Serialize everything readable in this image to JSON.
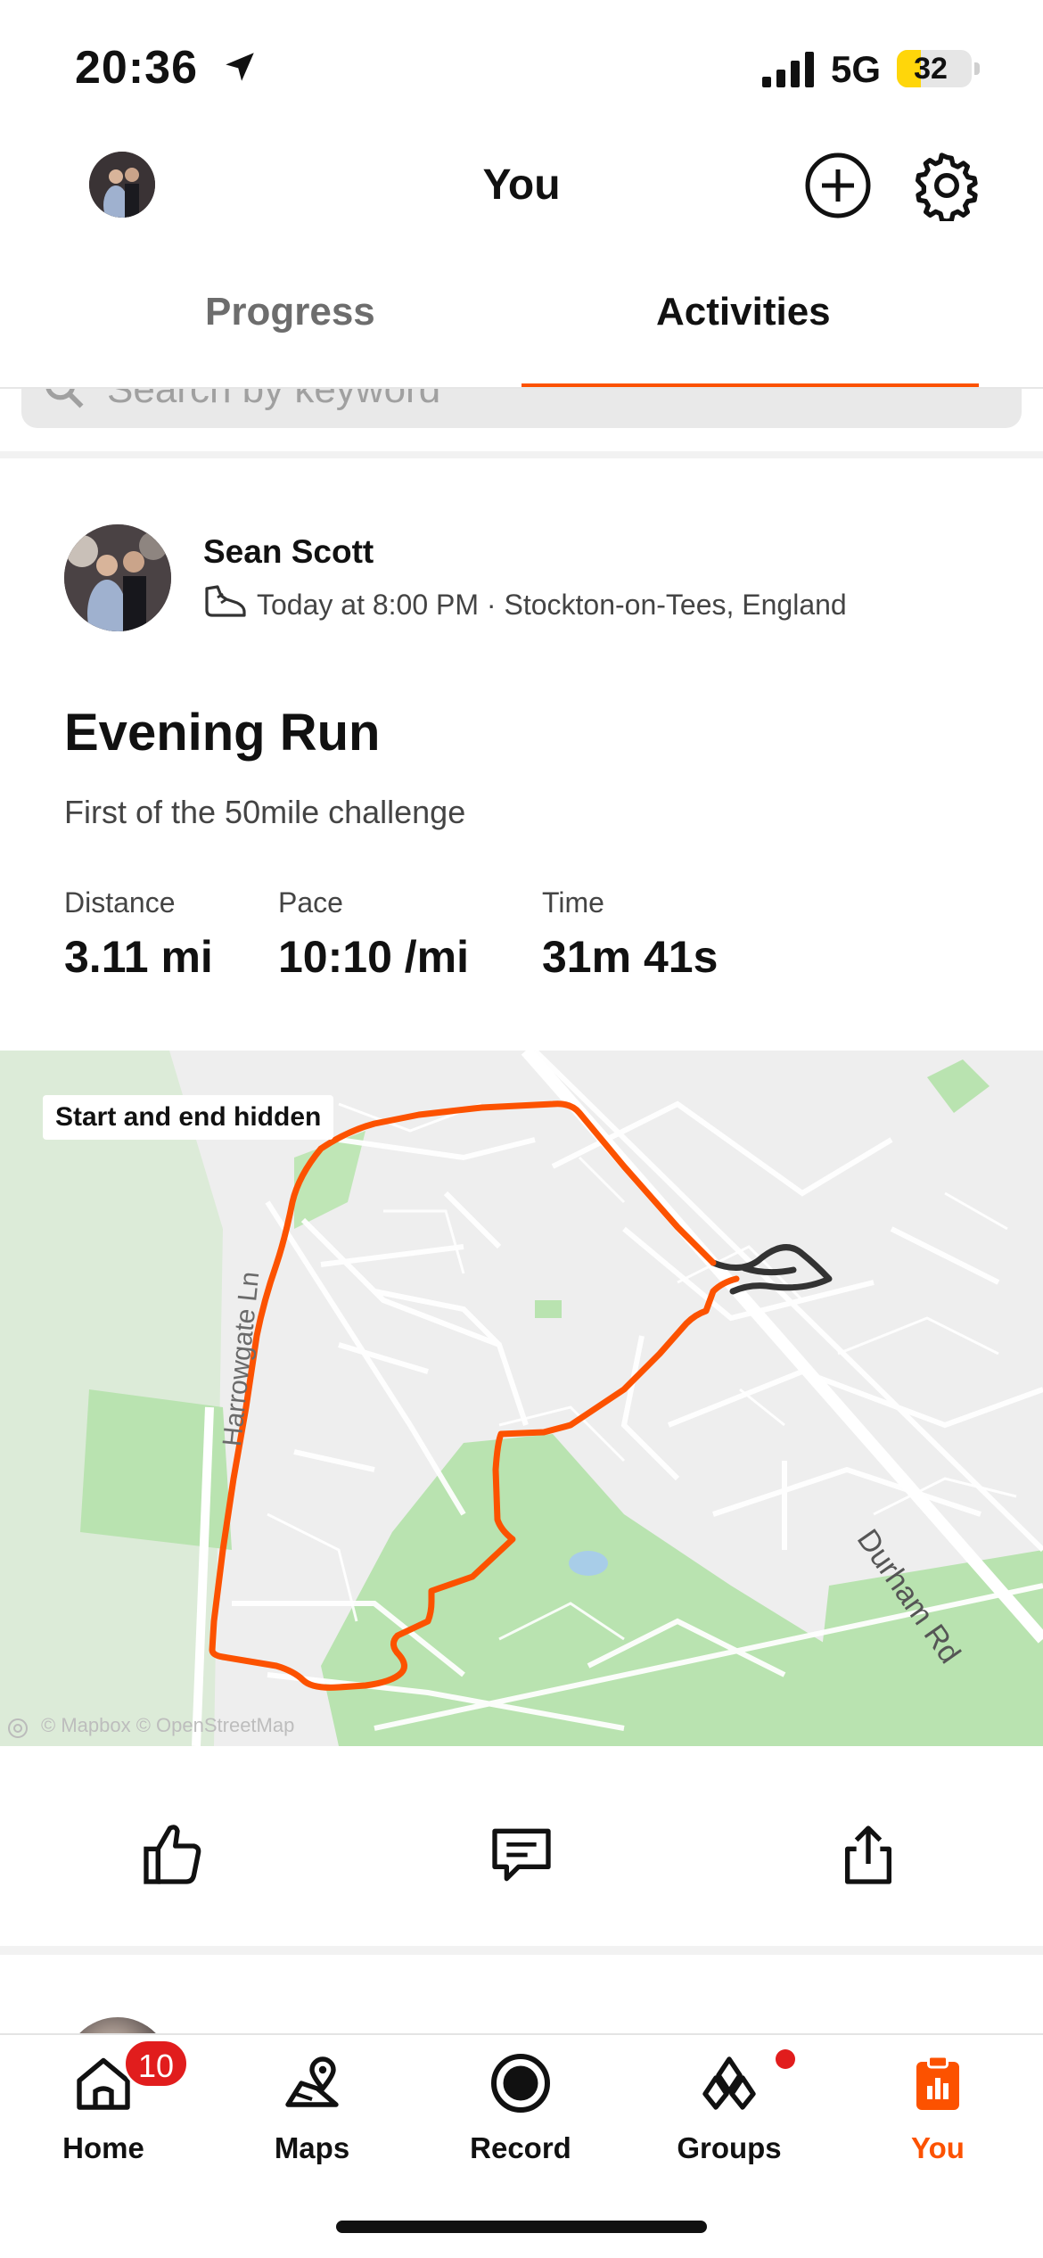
{
  "status_bar": {
    "time": "20:36",
    "network": "5G",
    "battery": "32",
    "battery_level": 0.32
  },
  "header": {
    "title": "You"
  },
  "tabs": [
    {
      "label": "Progress",
      "active": false
    },
    {
      "label": "Activities",
      "active": true
    }
  ],
  "search": {
    "placeholder": "Search by keyword"
  },
  "activity": {
    "athlete": "Sean Scott",
    "meta": "Today at 8:00 PM · Stockton-on-Tees, England",
    "title": "Evening Run",
    "description": "First of the 50mile challenge",
    "stats": [
      {
        "label": "Distance",
        "value": "3.11 mi"
      },
      {
        "label": "Pace",
        "value": "10:10 /mi"
      },
      {
        "label": "Time",
        "value": "31m 41s"
      }
    ],
    "map": {
      "badge": "Start and end hidden",
      "road_label": "Durham Rd",
      "side_road_label": "Harrowgate Ln",
      "credit": "© Mapbox © OpenStreetMap",
      "route_color": "#fc5200",
      "hidden_route_color": "#333333"
    }
  },
  "bottom_nav": {
    "items": [
      {
        "label": "Home",
        "icon": "home-icon",
        "badge": "10"
      },
      {
        "label": "Maps",
        "icon": "maps-icon"
      },
      {
        "label": "Record",
        "icon": "record-icon"
      },
      {
        "label": "Groups",
        "icon": "groups-icon"
      },
      {
        "label": "You",
        "icon": "you-icon",
        "active": true
      }
    ]
  },
  "colors": {
    "accent": "#fc5200",
    "badge": "#e11d1d"
  }
}
